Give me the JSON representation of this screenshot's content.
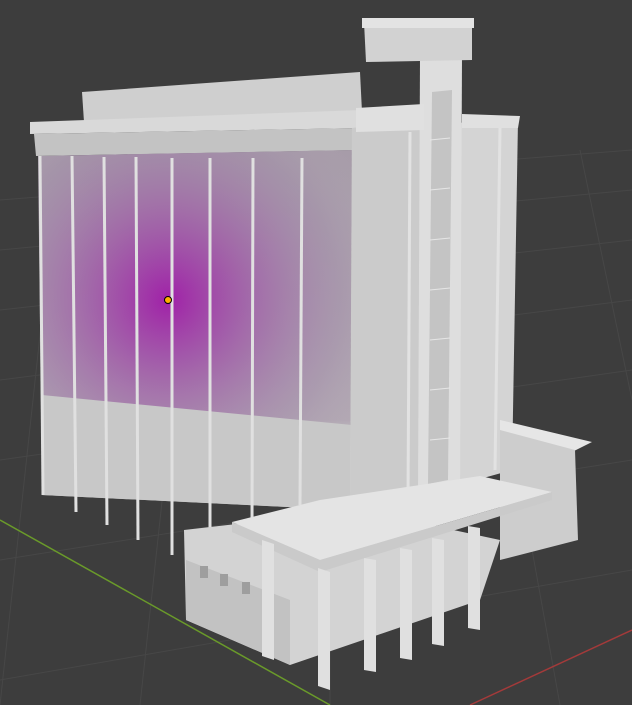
{
  "viewport": {
    "background": "#3d3d3d",
    "grid_color": "#4a4a4a",
    "x_axis_color": "#a33a3a",
    "y_axis_color": "#6a9a2a"
  },
  "model": {
    "body_color": "#d6d6d6",
    "shadow_color": "#b8b8b8",
    "light_color": "#a01aa8",
    "light_marker_color": "#ffae00"
  }
}
